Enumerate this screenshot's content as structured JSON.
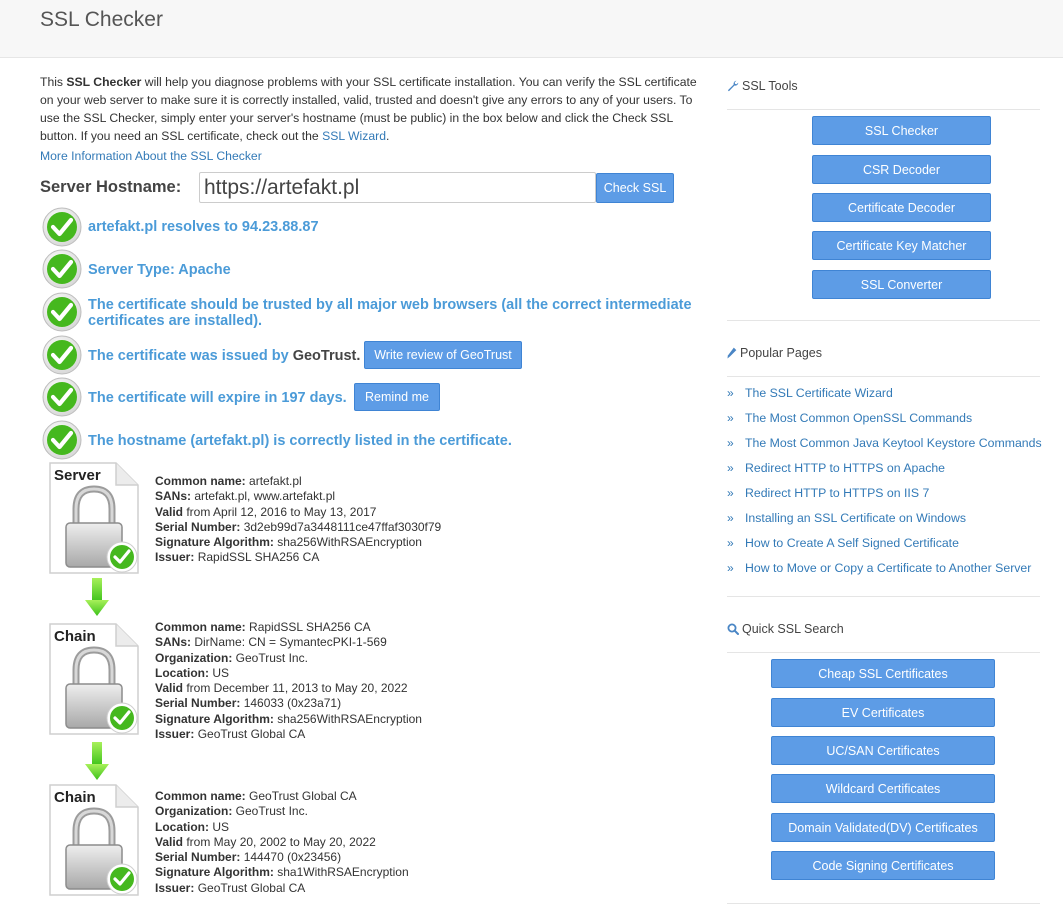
{
  "page": {
    "title": "SSL Checker"
  },
  "intro": {
    "p1": "This ",
    "b1": "SSL Checker",
    "p2": " will help you diagnose problems with your SSL certificate installation. You can verify the SSL certificate on your web server to make sure it is correctly installed, valid, trusted and doesn't give any errors to any of your users. To use the SSL Checker, simply enter your server's hostname (must be public) in the box below and click the Check SSL button. If you need an SSL certificate, check out the ",
    "link": "SSL Wizard",
    "p3": "."
  },
  "more_info": "More Information About the SSL Checker",
  "form": {
    "label": "Server Hostname:",
    "value": "https://artefakt.pl",
    "button": "Check SSL"
  },
  "results": {
    "resolves": "artefakt.pl resolves to 94.23.88.87",
    "server_type": "Server Type: Apache",
    "trusted": "The certificate should be trusted by all major web browsers (all the correct intermediate certificates are installed).",
    "issued_prefix": "The certificate was issued by ",
    "issuer": "GeoTrust",
    "issued_suffix": ".",
    "review_button": "Write review of GeoTrust",
    "expire": "The certificate will expire in 197 days.",
    "remind_button": "Remind me",
    "hostname": "The hostname (artefakt.pl) is correctly listed in the certificate."
  },
  "certs": {
    "server": {
      "badge": "Server",
      "rows": [
        {
          "k": "Common name:",
          "v": " artefakt.pl"
        },
        {
          "k": "SANs:",
          "v": " artefakt.pl, www.artefakt.pl"
        },
        {
          "k": "Valid",
          "v": " from April 12, 2016 to May 13, 2017"
        },
        {
          "k": "Serial Number:",
          "v": " 3d2eb99d7a3448111ce47ffaf3030f79"
        },
        {
          "k": "Signature Algorithm:",
          "v": " sha256WithRSAEncryption"
        },
        {
          "k": "Issuer:",
          "v": " RapidSSL SHA256 CA"
        }
      ]
    },
    "chain1": {
      "badge": "Chain",
      "rows": [
        {
          "k": "Common name:",
          "v": " RapidSSL SHA256 CA"
        },
        {
          "k": "SANs:",
          "v": " DirName: CN = SymantecPKI-1-569"
        },
        {
          "k": "Organization:",
          "v": " GeoTrust Inc."
        },
        {
          "k": "Location:",
          "v": " US"
        },
        {
          "k": "Valid",
          "v": " from December 11, 2013 to May 20, 2022"
        },
        {
          "k": "Serial Number:",
          "v": " 146033 (0x23a71)"
        },
        {
          "k": "Signature Algorithm:",
          "v": " sha256WithRSAEncryption"
        },
        {
          "k": "Issuer:",
          "v": " GeoTrust Global CA"
        }
      ]
    },
    "chain2": {
      "badge": "Chain",
      "rows": [
        {
          "k": "Common name:",
          "v": " GeoTrust Global CA"
        },
        {
          "k": "Organization:",
          "v": " GeoTrust Inc."
        },
        {
          "k": "Location:",
          "v": " US"
        },
        {
          "k": "Valid",
          "v": " from May 20, 2002 to May 20, 2022"
        },
        {
          "k": "Serial Number:",
          "v": " 144470 (0x23456)"
        },
        {
          "k": "Signature Algorithm:",
          "v": " sha1WithRSAEncryption"
        },
        {
          "k": "Issuer:",
          "v": " GeoTrust Global CA"
        }
      ]
    }
  },
  "sidebar": {
    "tools_heading": "SSL Tools",
    "tools": [
      "SSL Checker",
      "CSR Decoder",
      "Certificate Decoder",
      "Certificate Key Matcher",
      "SSL Converter"
    ],
    "popular_heading": "Popular Pages",
    "popular": [
      "The SSL Certificate Wizard",
      "The Most Common OpenSSL Commands",
      "The Most Common Java Keytool Keystore Commands",
      "Redirect HTTP to HTTPS on Apache",
      "Redirect HTTP to HTTPS on IIS 7",
      "Installing an SSL Certificate on Windows",
      "How to Create A Self Signed Certificate",
      "How to Move or Copy a Certificate to Another Server"
    ],
    "search_heading": "Quick SSL Search",
    "search": [
      "Cheap SSL Certificates",
      "EV Certificates",
      "UC/SAN Certificates",
      "Wildcard Certificates",
      "Domain Validated(DV) Certificates",
      "Code Signing Certificates"
    ]
  },
  "colors": {
    "accent": "#5d9ce6",
    "link": "#337ab7",
    "result": "#4b9bd8",
    "check": "#3fb619"
  }
}
